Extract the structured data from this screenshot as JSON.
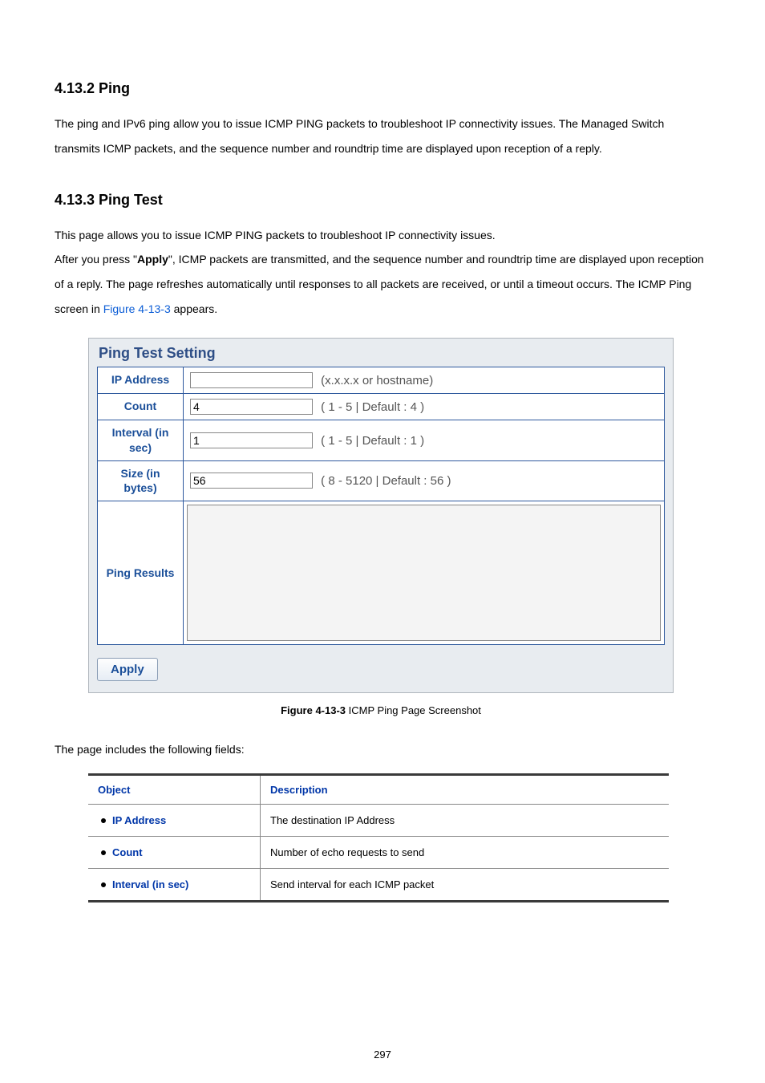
{
  "section1": {
    "heading": "4.13.2 Ping",
    "para": "The ping and IPv6 ping allow you to issue ICMP PING packets to troubleshoot IP connectivity issues. The Managed Switch transmits ICMP packets, and the sequence number and roundtrip time are displayed upon reception of a reply."
  },
  "section2": {
    "heading": "4.13.3 Ping Test",
    "para_a": "This page allows you to issue ICMP PING packets to troubleshoot IP connectivity issues.",
    "para_b_pre": "After you press \"",
    "para_b_bold": "Apply",
    "para_b_mid": "\", ICMP packets are transmitted, and the sequence number and roundtrip time are displayed upon reception of a reply. The page refreshes automatically until responses to all packets are received, or until a timeout occurs. The ICMP Ping screen in ",
    "para_b_link": "Figure 4-13-3",
    "para_b_post": " appears."
  },
  "panel": {
    "title": "Ping Test Setting",
    "rows": {
      "ip": {
        "label": "IP Address",
        "value": "",
        "hint": "(x.x.x.x or hostname)"
      },
      "count": {
        "label": "Count",
        "value": "4",
        "hint": "( 1 - 5 | Default : 4 )"
      },
      "interval": {
        "label": "Interval (in sec)",
        "value": "1",
        "hint": "( 1 - 5 | Default : 1 )"
      },
      "size": {
        "label": "Size (in bytes)",
        "value": "56",
        "hint": "( 8 - 5120 | Default :  56 )"
      },
      "results": {
        "label": "Ping Results",
        "value": ""
      }
    },
    "apply": "Apply"
  },
  "caption": {
    "bold": "Figure 4-13-3",
    "rest": " ICMP Ping Page Screenshot"
  },
  "fields_intro": "The page includes the following fields:",
  "fields_table": {
    "head": {
      "object": "Object",
      "description": "Description"
    },
    "rows": [
      {
        "object": "IP Address",
        "description": "The destination IP Address"
      },
      {
        "object": "Count",
        "description": "Number of echo requests to send"
      },
      {
        "object": "Interval (in sec)",
        "description": "Send interval for each ICMP packet"
      }
    ]
  },
  "page_number": "297"
}
